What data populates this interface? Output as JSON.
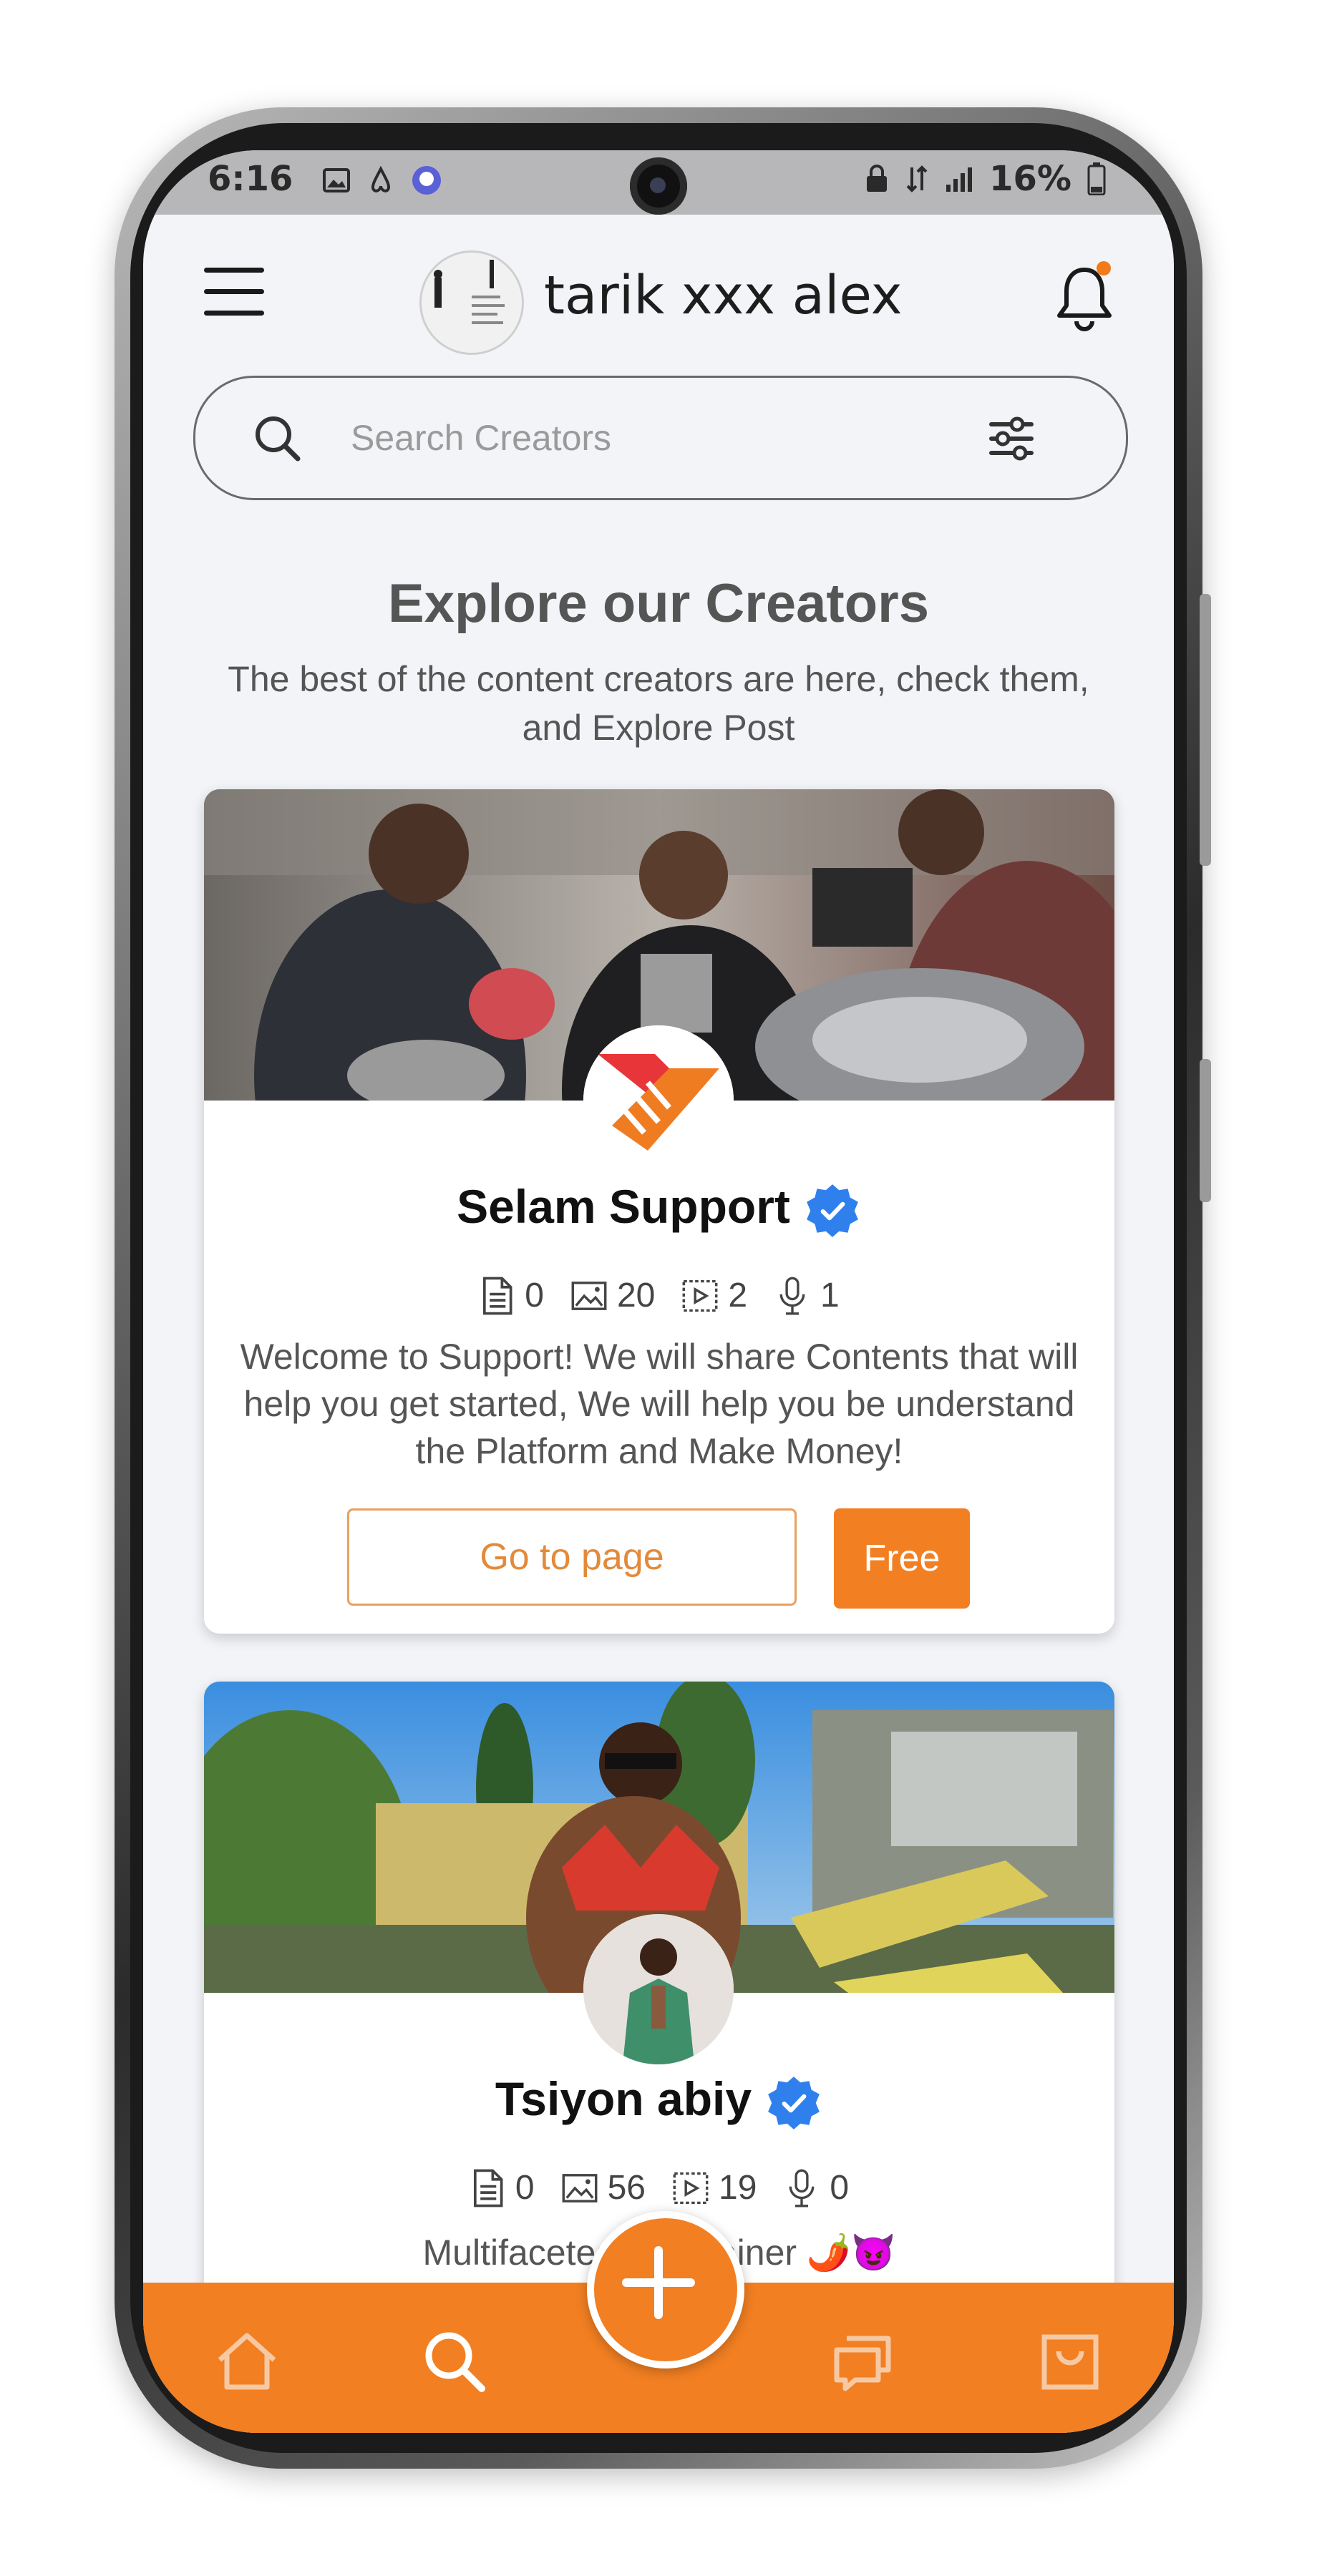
{
  "status_bar": {
    "time": "6:16",
    "battery": "16%",
    "icons": [
      "image-icon",
      "airbnb-icon",
      "app-icon",
      "lock-icon",
      "data-icon",
      "signal-icon",
      "battery-icon"
    ]
  },
  "header": {
    "user_name": "tarik xxx alex",
    "icons": [
      "menu-icon",
      "bell-icon"
    ]
  },
  "search": {
    "placeholder": "Search Creators"
  },
  "section": {
    "title": "Explore our Creators",
    "subtitle": "The best of the content creators are here, check them, and Explore Post"
  },
  "creators": [
    {
      "name": "Selam Support",
      "verified": true,
      "stats": {
        "posts": "0",
        "images": "20",
        "videos": "2",
        "audio": "1"
      },
      "description": "Welcome to Support! We will share Contents that will help you get started, We will help you be understand the Platform and Make Money!",
      "go_to_page_label": "Go to page",
      "price_label": "Free"
    },
    {
      "name": "Tsiyon abiy",
      "verified": true,
      "stats": {
        "posts": "0",
        "images": "56",
        "videos": "19",
        "audio": "0"
      },
      "description": "Multifaceted entertainer 🌶️😈"
    }
  ],
  "bottom_nav": [
    "home-icon",
    "search-icon",
    "add-icon",
    "chat-icon",
    "bag-icon"
  ],
  "colors": {
    "accent": "#F27F22",
    "verified": "#2F80ED",
    "background": "#F2F4F8"
  }
}
